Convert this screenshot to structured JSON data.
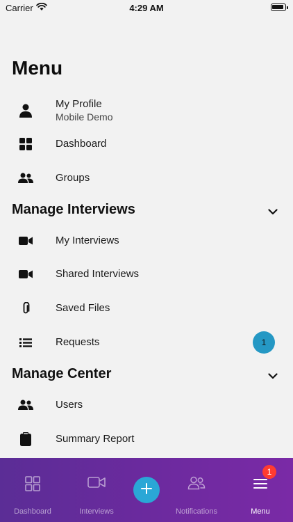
{
  "status_bar": {
    "carrier": "Carrier",
    "time": "4:29 AM"
  },
  "page": {
    "title": "Menu"
  },
  "profile": {
    "name": "My Profile",
    "subtitle": "Mobile Demo",
    "icon": "person-icon"
  },
  "top_items": [
    {
      "label": "Dashboard",
      "icon": "grid-icon"
    },
    {
      "label": "Groups",
      "icon": "people-icon"
    }
  ],
  "sections": [
    {
      "title": "Manage Interviews",
      "items": [
        {
          "label": "My Interviews",
          "icon": "video-icon"
        },
        {
          "label": "Shared Interviews",
          "icon": "video-icon"
        },
        {
          "label": "Saved Files",
          "icon": "paperclip-icon"
        },
        {
          "label": "Requests",
          "icon": "list-icon",
          "badge": "1"
        }
      ]
    },
    {
      "title": "Manage Center",
      "items": [
        {
          "label": "Users",
          "icon": "people-icon"
        },
        {
          "label": "Summary Report",
          "icon": "clipboard-icon"
        }
      ]
    }
  ],
  "tab_bar": {
    "tabs": [
      {
        "label": "Dashboard",
        "icon": "grid-outline-icon"
      },
      {
        "label": "Interviews",
        "icon": "video-outline-icon"
      },
      {
        "label": "Notifications",
        "icon": "people-outline-icon"
      },
      {
        "label": "Menu",
        "icon": "hamburger-icon",
        "badge": "1",
        "active": true
      }
    ],
    "fab_icon": "plus-icon"
  },
  "colors": {
    "background": "#f2f2f2",
    "tab_bar_start": "#5b2d96",
    "tab_bar_end": "#7a2aa6",
    "fab": "#2aa7d6",
    "badge_blue": "#2598c4",
    "badge_red": "#ff3b30"
  }
}
